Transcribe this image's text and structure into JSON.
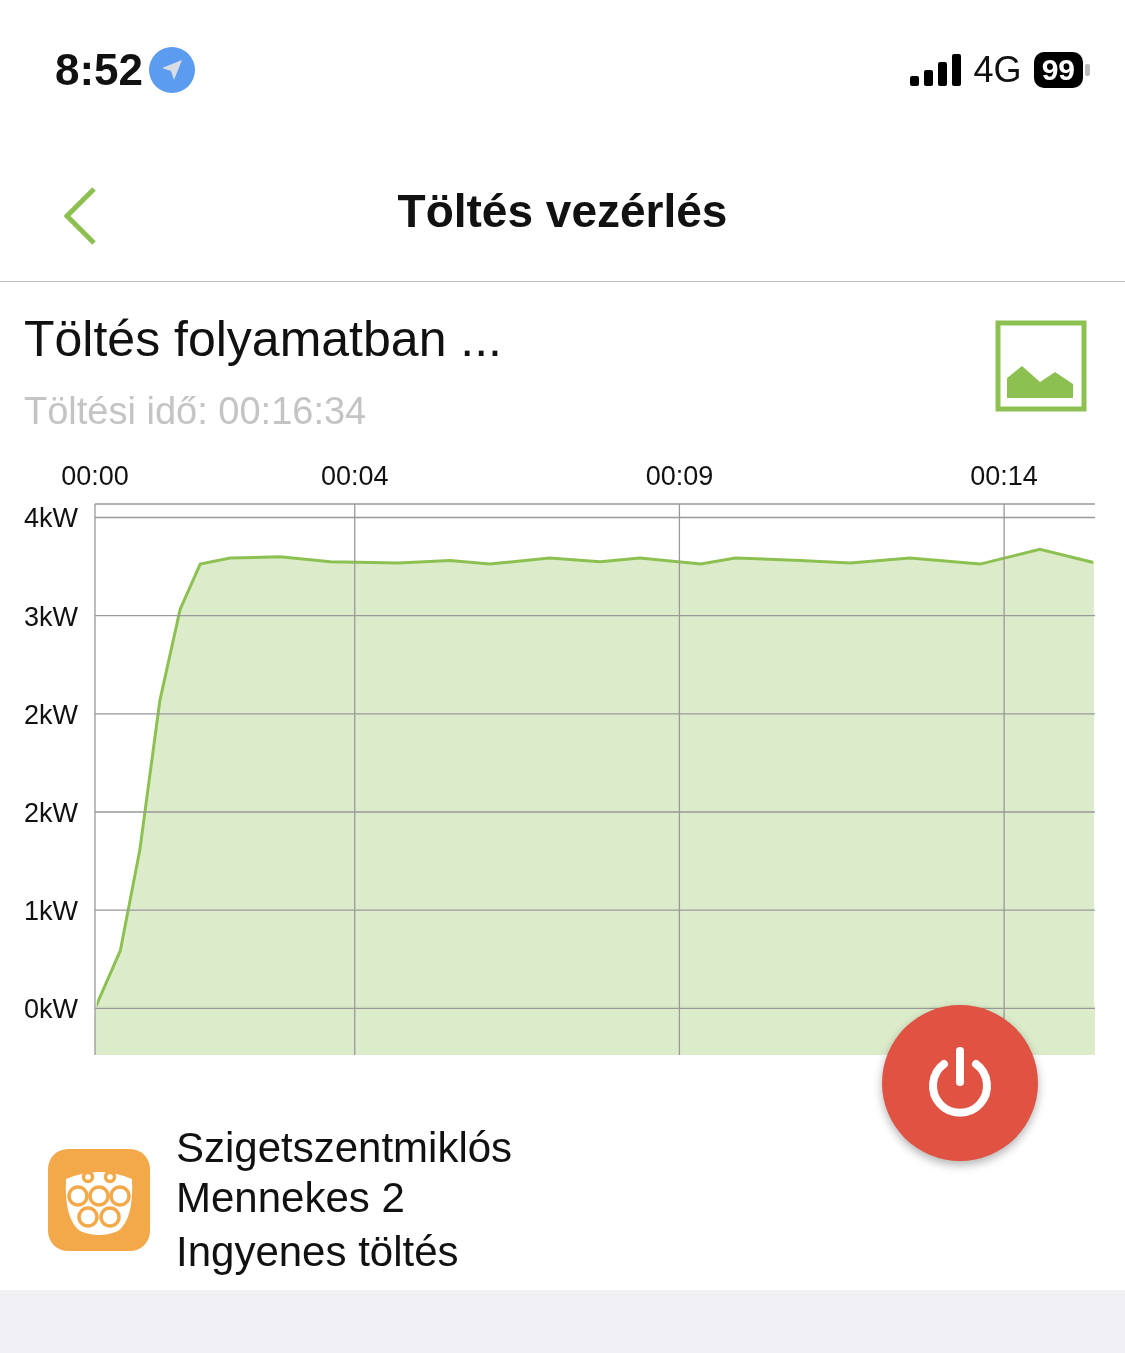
{
  "status_bar": {
    "time": "8:52",
    "network": "4G",
    "battery": "99"
  },
  "nav": {
    "title": "Töltés vezérlés"
  },
  "charge": {
    "status": "Töltés folyamatban ...",
    "duration": "Töltési idő: 00:16:34",
    "chart_data": {
      "type": "area",
      "x": [
        0,
        0.39,
        0.69,
        1.0,
        1.31,
        1.62,
        2.08,
        2.85,
        3.62,
        4.67,
        5.47,
        6.08,
        7.0,
        7.78,
        8.39,
        9.33,
        9.86,
        10.86,
        11.63,
        12.55,
        13.63,
        14.55,
        15.4
      ],
      "series": [
        {
          "color": "#8cc152",
          "values": [
            0,
            0.47,
            1.29,
            2.51,
            3.25,
            3.62,
            3.67,
            3.68,
            3.64,
            3.63,
            3.65,
            3.62,
            3.67,
            3.64,
            3.67,
            3.62,
            3.67,
            3.65,
            3.63,
            3.67,
            3.62,
            3.74,
            3.63
          ]
        }
      ],
      "grid": true,
      "xlim": [
        0,
        15.4
      ],
      "ylim": [
        -0.38,
        4.11
      ],
      "xticks": [
        {
          "value": 0,
          "label": "00:00"
        },
        {
          "value": 4,
          "label": "00:04"
        },
        {
          "value": 9,
          "label": "00:09"
        },
        {
          "value": 14,
          "label": "00:14"
        }
      ],
      "yticks": [
        {
          "value": 0,
          "label": "0kW"
        },
        {
          "value": 0.8,
          "label": "1kW"
        },
        {
          "value": 1.6,
          "label": "2kW"
        },
        {
          "value": 2.4,
          "label": "2kW"
        },
        {
          "value": 3.2,
          "label": "3kW"
        },
        {
          "value": 4.0,
          "label": "4kW"
        }
      ]
    }
  },
  "station": {
    "name": "Szigetszentmiklós",
    "connector": "Mennekes 2",
    "tariff": "Ingyenes töltés"
  }
}
